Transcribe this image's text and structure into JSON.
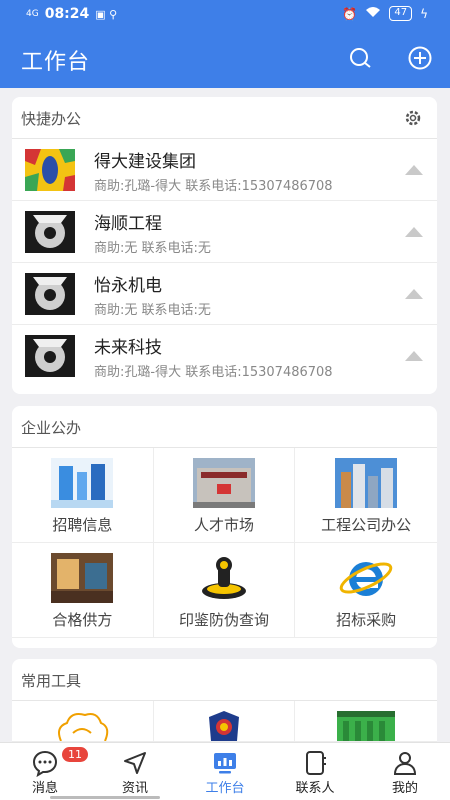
{
  "status": {
    "network": "4G",
    "time": "08:24",
    "battery": "47"
  },
  "header": {
    "title": "工作台"
  },
  "quick": {
    "title": "快捷办公",
    "items": [
      {
        "name": "得大建设集团",
        "meta": "商助:孔璐-得大   联系电话:15307486708"
      },
      {
        "name": "海顺工程",
        "meta": "商助:无   联系电话:无"
      },
      {
        "name": "怡永机电",
        "meta": "商助:无   联系电话:无"
      },
      {
        "name": "未来科技",
        "meta": "商助:孔璐-得大   联系电话:15307486708"
      }
    ]
  },
  "enterprise": {
    "title": "企业公办",
    "items": [
      {
        "label": "招聘信息"
      },
      {
        "label": "人才市场"
      },
      {
        "label": "工程公司办公"
      },
      {
        "label": "合格供方"
      },
      {
        "label": "印鉴防伪查询"
      },
      {
        "label": "招标采购"
      }
    ]
  },
  "tools": {
    "title": "常用工具"
  },
  "tabbar": {
    "badge": "11",
    "items": [
      {
        "label": "消息",
        "icon": "chat-icon"
      },
      {
        "label": "资讯",
        "icon": "navigation-icon"
      },
      {
        "label": "工作台",
        "icon": "dashboard-icon"
      },
      {
        "label": "联系人",
        "icon": "contacts-icon"
      },
      {
        "label": "我的",
        "icon": "profile-icon"
      }
    ]
  },
  "colors": {
    "primary": "#3e7fe8",
    "badge": "#e8453c"
  }
}
